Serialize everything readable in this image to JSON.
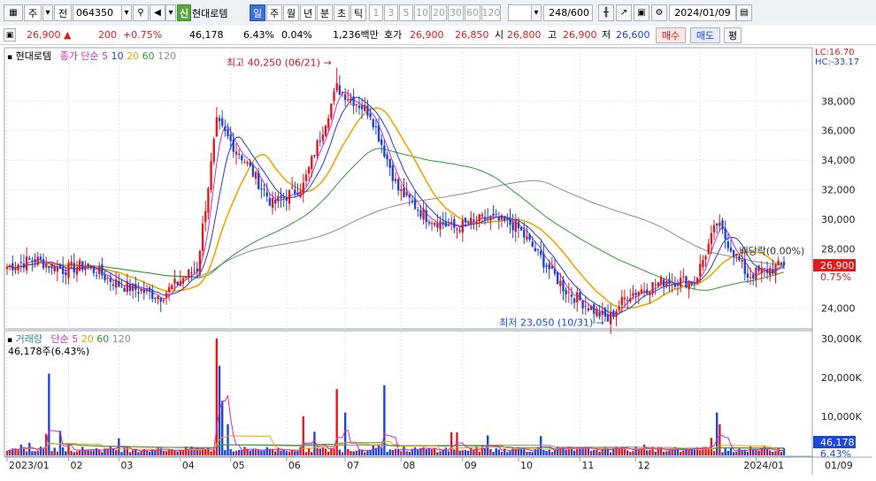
{
  "toolbar": {
    "market_label": "주",
    "prev_label": "전",
    "stock_code": "064350",
    "stock_badge": "신",
    "stock_name": "현대로템",
    "periods": [
      "일",
      "주",
      "월",
      "년",
      "분",
      "초",
      "틱"
    ],
    "active_period": "일",
    "intervals": [
      "1",
      "3",
      "5",
      "10",
      "20",
      "30",
      "60",
      "120"
    ],
    "count": "248",
    "count_max": "/600",
    "date": "2024/01/09"
  },
  "quote": {
    "price": "26,900",
    "change_arrow": "▲",
    "change": "200",
    "change_pct": "+0.75%",
    "volume": "46,178",
    "volume_pct": "6.43%",
    "turnover_pct": "0.04%",
    "amount": "1,236백만",
    "hoga_label": "호가",
    "hoga_ask": "26,900",
    "hoga_bid": "26,850",
    "open_label": "시",
    "open": "26,800",
    "high_label": "고",
    "high": "26,900",
    "low_label": "저",
    "low": "26,600",
    "buy_label": "매수",
    "sell_label": "매도",
    "eval_label": "평"
  },
  "colors": {
    "up": "#e01b1b",
    "down": "#1b48d8",
    "ma5": "#d12bc8",
    "ma10": "#1f3fd0",
    "ma20": "#f0a500",
    "ma60": "#2e9a2e",
    "ma120": "#8c8c8c"
  },
  "price_panel": {
    "name": "현대로템",
    "indicator": "종가 단순",
    "periods": [
      "5",
      "10",
      "20",
      "60",
      "120"
    ],
    "lc": "LC:16.70",
    "hc": "HC:-33.17",
    "y_ticks": [
      "38,000",
      "36,000",
      "34,000",
      "32,000",
      "30,000",
      "28,000",
      "24,000"
    ],
    "last_price_badge": "26,900",
    "last_pct_badge": "0.75%",
    "max_annotation": "최고 40,250 (06/21)",
    "min_annotation": "최저 23,050 (10/31)",
    "dividend_note": "배당락(0.00%)"
  },
  "volume_panel": {
    "name": "거래량",
    "indicator": "단순",
    "periods": [
      "5",
      "20",
      "60",
      "120"
    ],
    "value_text": "46,178주(6.43%)",
    "y_ticks": [
      "30,000K",
      "20,000K",
      "10,000K"
    ],
    "last_vol_badge": "46,178",
    "last_pct_badge": "6.43%"
  },
  "x_axis": {
    "labels": [
      "2023/01",
      "02",
      "03",
      "04",
      "05",
      "06",
      "07",
      "08",
      "09",
      "10",
      "11",
      "12",
      "2024/01"
    ],
    "right_label": "01/09"
  },
  "chart_data": {
    "type": "candlestick",
    "series_price": {
      "name": "현대로템",
      "close_anchors": [
        [
          0,
          26800
        ],
        [
          10,
          27300
        ],
        [
          20,
          26600
        ],
        [
          28,
          26900
        ],
        [
          40,
          25600
        ],
        [
          55,
          24800
        ],
        [
          62,
          25900
        ],
        [
          68,
          26700
        ],
        [
          75,
          36500
        ],
        [
          85,
          34000
        ],
        [
          95,
          31000
        ],
        [
          106,
          32300
        ],
        [
          118,
          38900
        ],
        [
          130,
          37200
        ],
        [
          140,
          32000
        ],
        [
          150,
          30200
        ],
        [
          160,
          29400
        ],
        [
          172,
          30100
        ],
        [
          182,
          29600
        ],
        [
          200,
          25200
        ],
        [
          215,
          23200
        ],
        [
          222,
          24900
        ],
        [
          236,
          25900
        ],
        [
          246,
          25800
        ],
        [
          254,
          29700
        ],
        [
          265,
          26200
        ],
        [
          278,
          26900
        ]
      ],
      "high": 40250,
      "low": 23050,
      "last_close": 26900
    },
    "series_volume": {
      "name": "거래량",
      "last_value": 46178,
      "ylim": [
        0,
        32000000
      ]
    },
    "ylim_price": [
      22600,
      41600
    ],
    "annotations": [
      "최고 40,250 (06/21)",
      "최저 23,050 (10/31)",
      "배당락(0.00%)"
    ]
  }
}
